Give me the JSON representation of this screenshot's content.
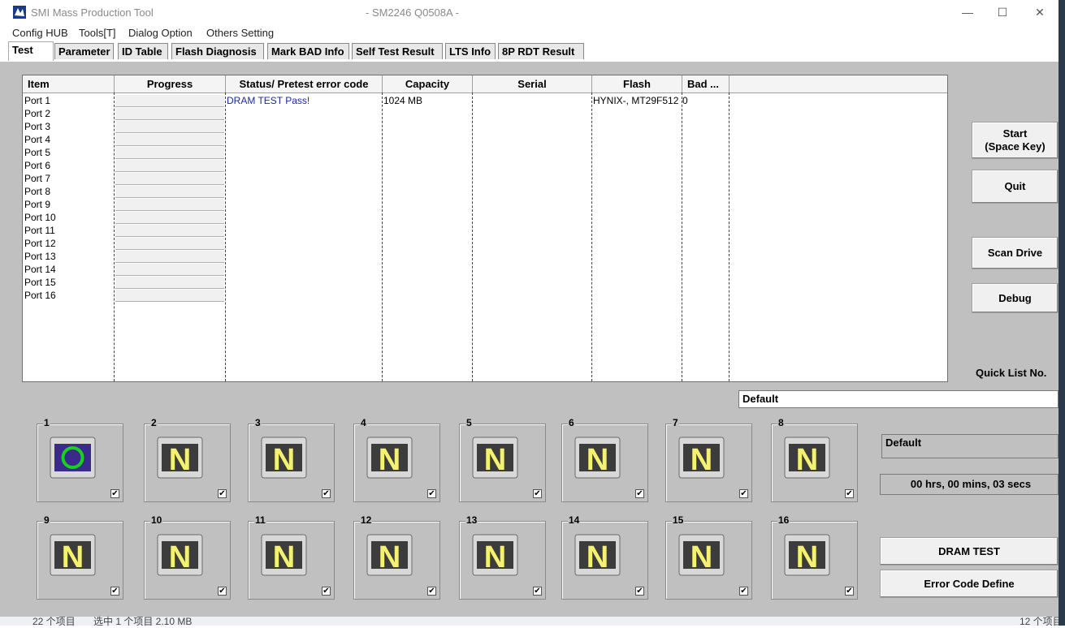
{
  "window": {
    "title": "SMI Mass Production Tool",
    "subtitle": "- SM2246 Q0508A -",
    "controls": {
      "minimize": "—",
      "maximize": "☐",
      "close": "✕"
    }
  },
  "menu": [
    "Config HUB",
    "Tools[T]",
    "Dialog Option",
    "Others Setting"
  ],
  "tabs": [
    "Test",
    "Parameter",
    "ID Table",
    "Flash Diagnosis",
    "Mark BAD Info",
    "Self Test Result",
    "LTS Info",
    "8P RDT Result"
  ],
  "active_tab": "Test",
  "table": {
    "columns": [
      "Item",
      "Progress",
      "Status/ Pretest error code",
      "Capacity",
      "Serial",
      "Flash",
      "Bad ..."
    ],
    "rows": [
      {
        "item": "Port 1",
        "status": "DRAM TEST Pass!",
        "capacity": "1024 MB",
        "serial": "",
        "flash": "HYNIX-, MT29F512",
        "bad": "0"
      },
      {
        "item": "Port 2"
      },
      {
        "item": "Port 3"
      },
      {
        "item": "Port 4"
      },
      {
        "item": "Port 5"
      },
      {
        "item": "Port 6"
      },
      {
        "item": "Port 7"
      },
      {
        "item": "Port 8"
      },
      {
        "item": "Port 9"
      },
      {
        "item": "Port 10"
      },
      {
        "item": "Port 11"
      },
      {
        "item": "Port 12"
      },
      {
        "item": "Port 13"
      },
      {
        "item": "Port 14"
      },
      {
        "item": "Port 15"
      },
      {
        "item": "Port 16"
      }
    ]
  },
  "buttons": {
    "start_line1": "Start",
    "start_line2": "(Space Key)",
    "quit": "Quit",
    "scan_drive": "Scan Drive",
    "debug": "Debug",
    "dram_test": "DRAM TEST",
    "error_code_define": "Error Code Define"
  },
  "quick_list": {
    "label": "Quick List No.",
    "value": "Default"
  },
  "profile_box": "Default",
  "timer": "00 hrs, 00 mins, 03 secs",
  "ports": [
    {
      "num": "1",
      "state": "O",
      "checked": "✔"
    },
    {
      "num": "2",
      "state": "N",
      "checked": "✔"
    },
    {
      "num": "3",
      "state": "N",
      "checked": "✔"
    },
    {
      "num": "4",
      "state": "N",
      "checked": "✔"
    },
    {
      "num": "5",
      "state": "N",
      "checked": "✔"
    },
    {
      "num": "6",
      "state": "N",
      "checked": "✔"
    },
    {
      "num": "7",
      "state": "N",
      "checked": "✔"
    },
    {
      "num": "8",
      "state": "N",
      "checked": "✔"
    },
    {
      "num": "9",
      "state": "N",
      "checked": "✔"
    },
    {
      "num": "10",
      "state": "N",
      "checked": "✔"
    },
    {
      "num": "11",
      "state": "N",
      "checked": "✔"
    },
    {
      "num": "12",
      "state": "N",
      "checked": "✔"
    },
    {
      "num": "13",
      "state": "N",
      "checked": "✔"
    },
    {
      "num": "14",
      "state": "N",
      "checked": "✔"
    },
    {
      "num": "15",
      "state": "N",
      "checked": "✔"
    },
    {
      "num": "16",
      "state": "N",
      "checked": "✔"
    }
  ],
  "colors": {
    "port_ok_bg": "#3a2a8a",
    "port_ok_ring": "#18d020",
    "port_idle_bg": "#3c3c3c",
    "port_idle_letter": "#f4f070",
    "status_text": "#1a2a9a"
  },
  "background_strip": {
    "left": "22 个项目",
    "left2": "选中 1 个项目  2.10 MB",
    "right": "12 个项目"
  }
}
